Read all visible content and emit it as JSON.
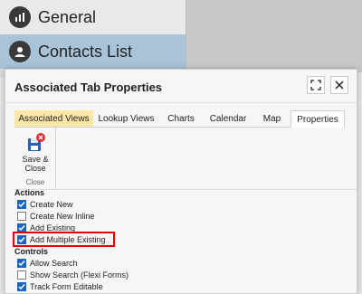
{
  "nav": {
    "general": "General",
    "contacts": "Contacts List"
  },
  "dialog": {
    "title": "Associated Tab Properties",
    "tabs": [
      "Associated Views",
      "Lookup Views",
      "Charts",
      "Calendar",
      "Map",
      "Properties"
    ],
    "ribbon": {
      "save_close": "Save & Close",
      "group": "Close"
    },
    "actions_head": "Actions",
    "actions": [
      {
        "label": "Create New",
        "checked": true
      },
      {
        "label": "Create New Inline",
        "checked": false
      },
      {
        "label": "Add Existing",
        "checked": true
      },
      {
        "label": "Add Multiple Existing",
        "checked": true
      }
    ],
    "controls_head": "Controls",
    "controls": [
      {
        "label": "Allow Search",
        "checked": true
      },
      {
        "label": "Show Search (Flexi Forms)",
        "checked": false
      },
      {
        "label": "Track Form Editable",
        "checked": true
      }
    ]
  },
  "colors": {
    "active_tab": "#fbe7a8",
    "nav_selected": "#a9c3d9",
    "highlight": "#e00000",
    "checkbox": "#1a64c4"
  }
}
